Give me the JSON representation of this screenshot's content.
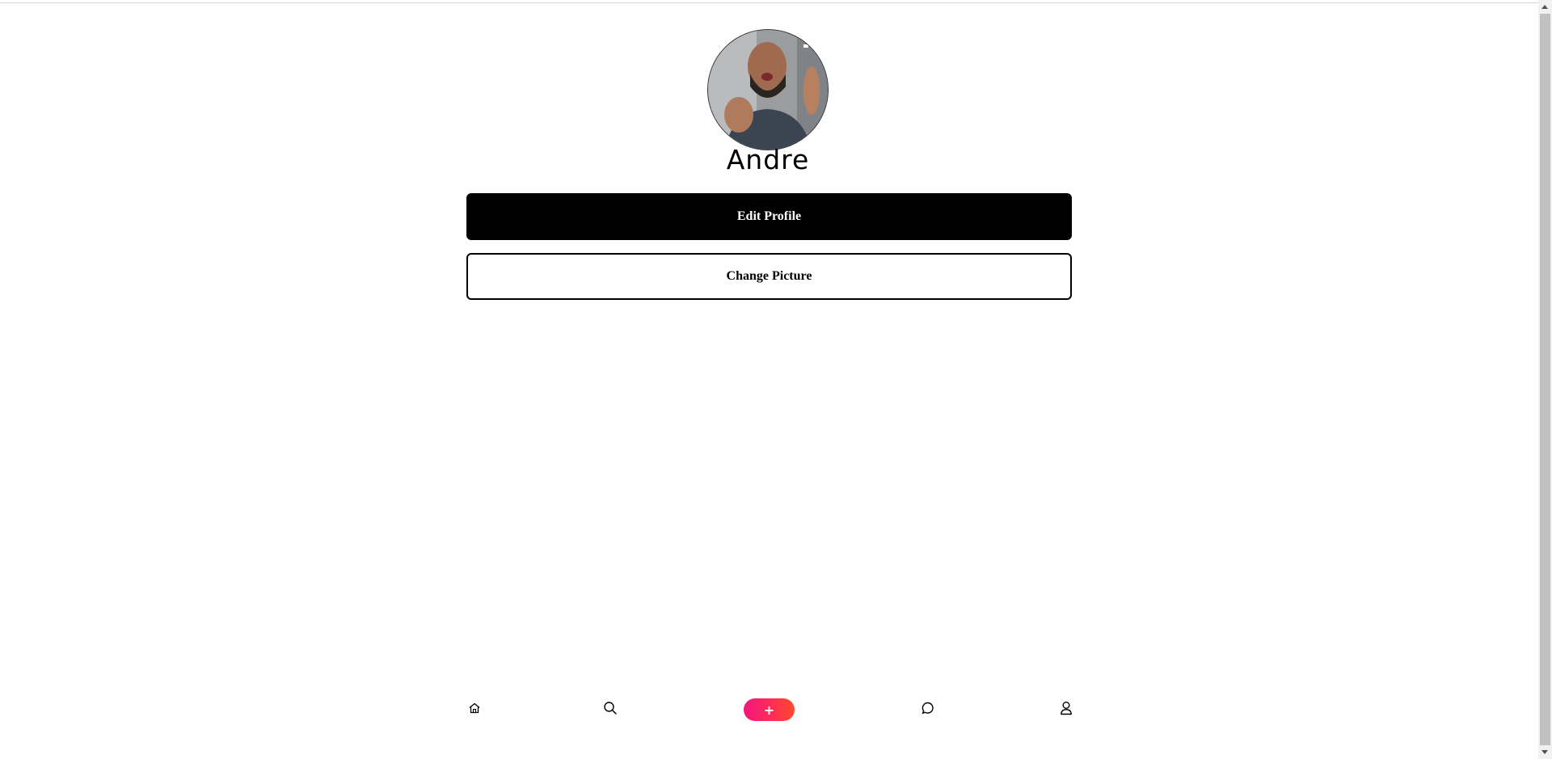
{
  "profile": {
    "name": "Andre",
    "avatar_icon": "user-photo"
  },
  "actions": {
    "edit_profile_label": "Edit Profile",
    "change_picture_label": "Change Picture"
  },
  "bottom_nav": {
    "items": [
      {
        "icon": "home-icon"
      },
      {
        "icon": "search-icon"
      },
      {
        "icon": "plus-icon",
        "label": "+"
      },
      {
        "icon": "chat-icon"
      },
      {
        "icon": "user-icon"
      }
    ],
    "add_gradient": [
      "#f0177e",
      "#ff4a2a"
    ]
  },
  "colors": {
    "primary_button_bg": "#000000",
    "primary_button_text": "#ffffff",
    "accent": "#ff2d55"
  }
}
